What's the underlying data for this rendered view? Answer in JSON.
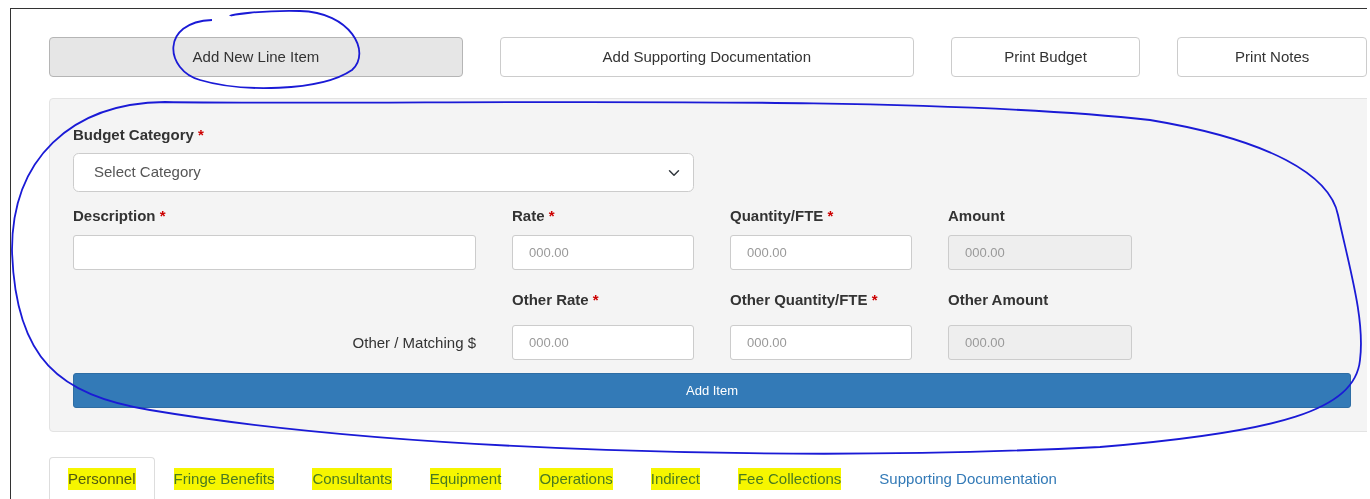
{
  "toolbar": [
    {
      "label": "Add New Line Item",
      "active": true
    },
    {
      "label": "Add Supporting Documentation",
      "active": false
    },
    {
      "label": "Print Budget",
      "active": false
    },
    {
      "label": "Print Notes",
      "active": false
    }
  ],
  "form": {
    "category": {
      "label": "Budget Category",
      "marker": "*",
      "placeholder": "Select Category"
    },
    "rows": [
      {
        "fields": [
          {
            "label": "Description",
            "marker": "*",
            "disabled": false
          },
          {
            "label": "Rate",
            "marker": "*",
            "placeholder": "000.00",
            "disabled": false
          },
          {
            "label": "Quantity/FTE",
            "marker": "*",
            "placeholder": "000.00",
            "disabled": false
          },
          {
            "label": "Amount",
            "placeholder": "000.00",
            "disabled": true
          }
        ]
      },
      {
        "row_label": "Other / Matching $",
        "fields": [
          {
            "label": "Other Rate",
            "marker": "*",
            "placeholder": "000.00",
            "disabled": false
          },
          {
            "label": "Other Quantity/FTE",
            "marker": "*",
            "placeholder": "000.00",
            "disabled": false
          },
          {
            "label": "Other Amount",
            "placeholder": "000.00",
            "disabled": true
          }
        ]
      }
    ],
    "submit": "Add Item"
  },
  "tabs": [
    {
      "label": "Personnel",
      "selected": true,
      "highlighted": true
    },
    {
      "label": "Fringe Benefits",
      "selected": false,
      "highlighted": true
    },
    {
      "label": "Consultants",
      "selected": false,
      "highlighted": true
    },
    {
      "label": "Equipment",
      "selected": false,
      "highlighted": true
    },
    {
      "label": "Operations",
      "selected": false,
      "highlighted": true
    },
    {
      "label": "Indirect",
      "selected": false,
      "highlighted": true
    },
    {
      "label": "Fee Collections",
      "selected": false,
      "highlighted": true
    },
    {
      "label": "Supporting Documentation",
      "selected": false,
      "highlighted": false
    }
  ]
}
